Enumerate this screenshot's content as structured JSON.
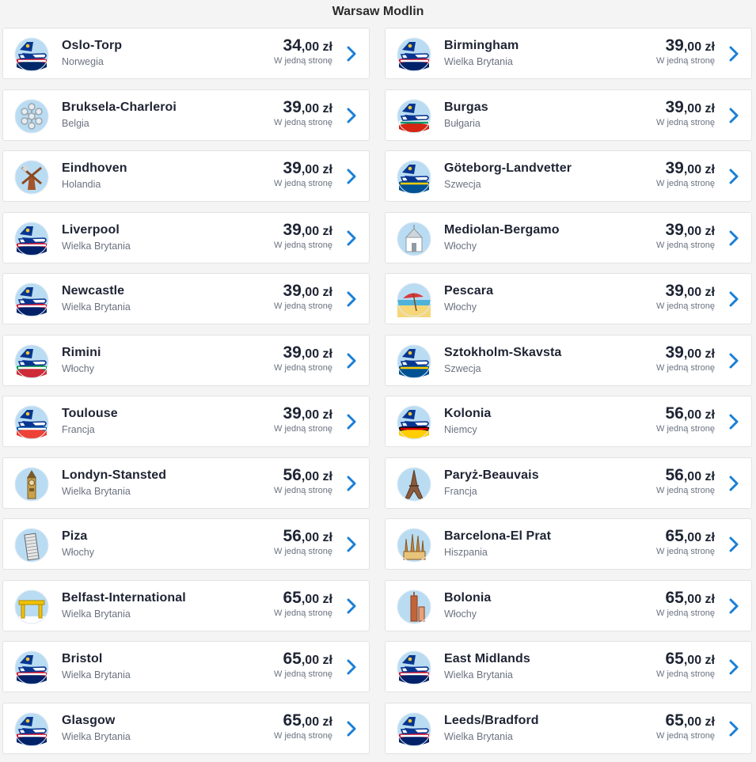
{
  "page_title": "Warsaw Modlin",
  "price_suffix": "W jedną stronę",
  "currency": "zł",
  "destinations": [
    {
      "city": "Oslo-Torp",
      "country": "Norwegia",
      "price_int": "34",
      "price_dec": ",00",
      "icon": "plane-norway-icon",
      "flag": [
        "#c8102e",
        "#ffffff",
        "#002868"
      ]
    },
    {
      "city": "Birmingham",
      "country": "Wielka Brytania",
      "price_int": "39",
      "price_dec": ",00",
      "icon": "plane-uk-icon",
      "flag": [
        "#c8102e",
        "#ffffff",
        "#012169"
      ]
    },
    {
      "city": "Bruksela-Charleroi",
      "country": "Belgia",
      "price_int": "39",
      "price_dec": ",00",
      "icon": "atomium-icon",
      "flag": [
        "#b8c4cc",
        "#e6ecf0",
        "#9aa6ae"
      ]
    },
    {
      "city": "Burgas",
      "country": "Bułgaria",
      "price_int": "39",
      "price_dec": ",00",
      "icon": "plane-bulgaria-icon",
      "flag": [
        "#ffffff",
        "#00966e",
        "#d62612"
      ]
    },
    {
      "city": "Eindhoven",
      "country": "Holandia",
      "price_int": "39",
      "price_dec": ",00",
      "icon": "windmill-icon",
      "flag": [
        "#a5542a",
        "#d9d9d9",
        "#8b4a22"
      ]
    },
    {
      "city": "Göteborg-Landvetter",
      "country": "Szwecja",
      "price_int": "39",
      "price_dec": ",00",
      "icon": "plane-sweden-icon",
      "flag": [
        "#005293",
        "#fecb00",
        "#005293"
      ]
    },
    {
      "city": "Liverpool",
      "country": "Wielka Brytania",
      "price_int": "39",
      "price_dec": ",00",
      "icon": "plane-uk-icon",
      "flag": [
        "#c8102e",
        "#ffffff",
        "#012169"
      ]
    },
    {
      "city": "Mediolan-Bergamo",
      "country": "Włochy",
      "price_int": "39",
      "price_dec": ",00",
      "icon": "cathedral-icon",
      "flag": [
        "#cfd6db",
        "#ffffff",
        "#8f9aa3"
      ]
    },
    {
      "city": "Newcastle",
      "country": "Wielka Brytania",
      "price_int": "39",
      "price_dec": ",00",
      "icon": "plane-uk-icon",
      "flag": [
        "#c8102e",
        "#ffffff",
        "#012169"
      ]
    },
    {
      "city": "Pescara",
      "country": "Włochy",
      "price_int": "39",
      "price_dec": ",00",
      "icon": "beach-umbrella-icon",
      "flag": [
        "#4fb3d9",
        "#f5d77a",
        "#d9363e"
      ]
    },
    {
      "city": "Rimini",
      "country": "Włochy",
      "price_int": "39",
      "price_dec": ",00",
      "icon": "plane-italy-icon",
      "flag": [
        "#009246",
        "#ffffff",
        "#ce2b37"
      ]
    },
    {
      "city": "Sztokholm-Skavsta",
      "country": "Szwecja",
      "price_int": "39",
      "price_dec": ",00",
      "icon": "plane-sweden-icon",
      "flag": [
        "#005293",
        "#fecb00",
        "#005293"
      ]
    },
    {
      "city": "Toulouse",
      "country": "Francja",
      "price_int": "39",
      "price_dec": ",00",
      "icon": "plane-france-icon",
      "flag": [
        "#0055a4",
        "#ffffff",
        "#ef4135"
      ]
    },
    {
      "city": "Kolonia",
      "country": "Niemcy",
      "price_int": "56",
      "price_dec": ",00",
      "icon": "plane-germany-icon",
      "flag": [
        "#000000",
        "#dd0000",
        "#ffce00"
      ]
    },
    {
      "city": "Londyn-Stansted",
      "country": "Wielka Brytania",
      "price_int": "56",
      "price_dec": ",00",
      "icon": "big-ben-icon",
      "flag": [
        "#c9a24a",
        "#7a5a2a",
        "#e9d9a6"
      ]
    },
    {
      "city": "Paryż-Beauvais",
      "country": "Francja",
      "price_int": "56",
      "price_dec": ",00",
      "icon": "eiffel-tower-icon",
      "flag": [
        "#8a5a3b",
        "#5b3a26",
        "#c9a27a"
      ]
    },
    {
      "city": "Piza",
      "country": "Włochy",
      "price_int": "56",
      "price_dec": ",00",
      "icon": "leaning-tower-icon",
      "flag": [
        "#e7e7e7",
        "#9aa0a6",
        "#5f6368"
      ]
    },
    {
      "city": "Barcelona-El Prat",
      "country": "Hiszpania",
      "price_int": "65",
      "price_dec": ",00",
      "icon": "sagrada-familia-icon",
      "flag": [
        "#c48a3a",
        "#8a5a22",
        "#e8c47a"
      ]
    },
    {
      "city": "Belfast-International",
      "country": "Wielka Brytania",
      "price_int": "65",
      "price_dec": ",00",
      "icon": "crane-icon",
      "flag": [
        "#f2c200",
        "#b08c00",
        "#ffffff"
      ]
    },
    {
      "city": "Bolonia",
      "country": "Włochy",
      "price_int": "65",
      "price_dec": ",00",
      "icon": "tower-icon",
      "flag": [
        "#c0643a",
        "#8a3f1f",
        "#e8a27a"
      ]
    },
    {
      "city": "Bristol",
      "country": "Wielka Brytania",
      "price_int": "65",
      "price_dec": ",00",
      "icon": "plane-uk-icon",
      "flag": [
        "#c8102e",
        "#ffffff",
        "#012169"
      ]
    },
    {
      "city": "East Midlands",
      "country": "Wielka Brytania",
      "price_int": "65",
      "price_dec": ",00",
      "icon": "plane-uk-icon",
      "flag": [
        "#c8102e",
        "#ffffff",
        "#012169"
      ]
    },
    {
      "city": "Glasgow",
      "country": "Wielka Brytania",
      "price_int": "65",
      "price_dec": ",00",
      "icon": "plane-uk-icon",
      "flag": [
        "#c8102e",
        "#ffffff",
        "#012169"
      ]
    },
    {
      "city": "Leeds/Bradford",
      "country": "Wielka Brytania",
      "price_int": "65",
      "price_dec": ",00",
      "icon": "plane-uk-icon",
      "flag": [
        "#c8102e",
        "#ffffff",
        "#012169"
      ]
    }
  ],
  "colors": {
    "accent": "#1a7fd6",
    "sky": "#b9dcf3",
    "plane_body": "#073590",
    "plane_tail_logo": "#f1c933"
  }
}
